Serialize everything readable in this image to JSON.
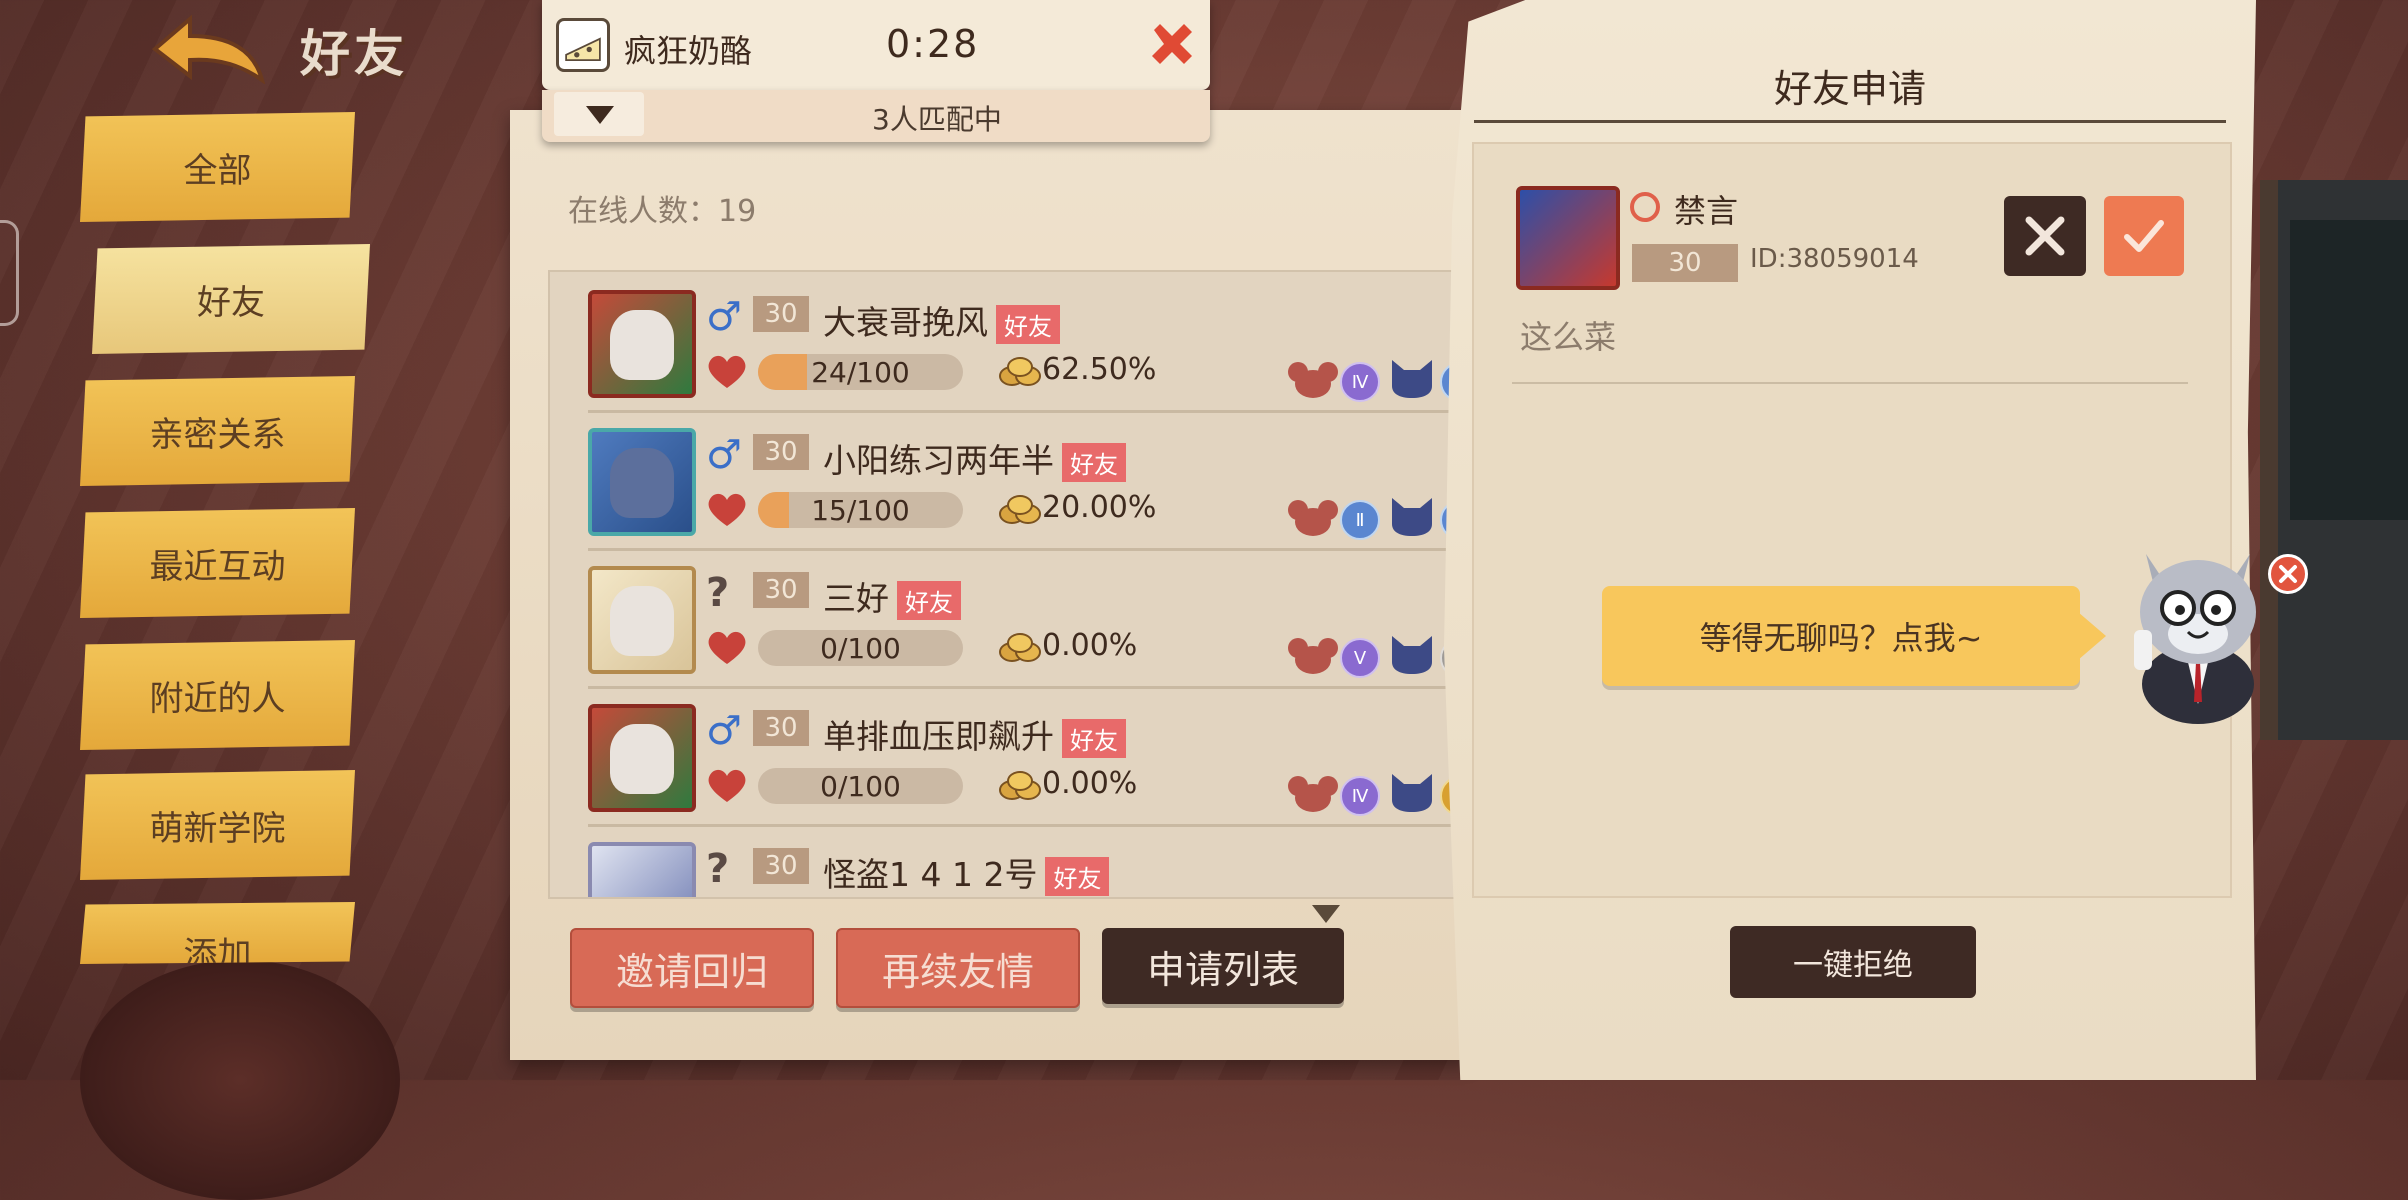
{
  "header": {
    "title": "好友"
  },
  "nav": {
    "items": [
      {
        "label": "全部"
      },
      {
        "label": "好友"
      },
      {
        "label": "亲密关系"
      },
      {
        "label": "最近互动"
      },
      {
        "label": "附近的人"
      },
      {
        "label": "萌新学院"
      },
      {
        "label": "添加"
      }
    ],
    "active_index": 1
  },
  "match": {
    "title": "疯狂奶酪",
    "timer": "0:28",
    "status": "3人匹配中"
  },
  "friends": {
    "online_label": "在线人数：19",
    "rows": [
      {
        "gender": "♂",
        "level": "30",
        "name": "大衰哥挽风",
        "tag": "好友",
        "progress": "24/100",
        "progress_frac": 0.24,
        "rate": "62.50%",
        "badge1": "Ⅳ",
        "badge2": "Ⅴ"
      },
      {
        "gender": "♂",
        "level": "30",
        "name": "小阳练习两年半",
        "tag": "好友",
        "progress": "15/100",
        "progress_frac": 0.15,
        "rate": "20.00%",
        "badge1": "Ⅱ",
        "badge2": "Ⅰ"
      },
      {
        "gender": "?",
        "level": "30",
        "name": "三好",
        "tag": "好友",
        "progress": "0/100",
        "progress_frac": 0,
        "rate": "0.00%",
        "badge1": "Ⅴ",
        "badge2": "Ⅰ"
      },
      {
        "gender": "♂",
        "level": "30",
        "name": "单排血压即飙升",
        "tag": "好友",
        "progress": "0/100",
        "progress_frac": 0,
        "rate": "0.00%",
        "badge1": "Ⅳ",
        "badge2": "Ⅳ"
      },
      {
        "gender": "?",
        "level": "30",
        "name": "怪盗1 4 1 2号",
        "tag": "好友"
      }
    ]
  },
  "actions": {
    "invite": "邀请回归",
    "renew": "再续友情",
    "requests": "申请列表"
  },
  "requests_panel": {
    "title": "好友申请",
    "request": {
      "name": "禁言",
      "level": "30",
      "id_label": "ID:38059014",
      "message": "这么菜"
    },
    "reject_all": "一键拒绝"
  },
  "assistant": {
    "bubble_text": "等得无聊吗？点我~"
  }
}
